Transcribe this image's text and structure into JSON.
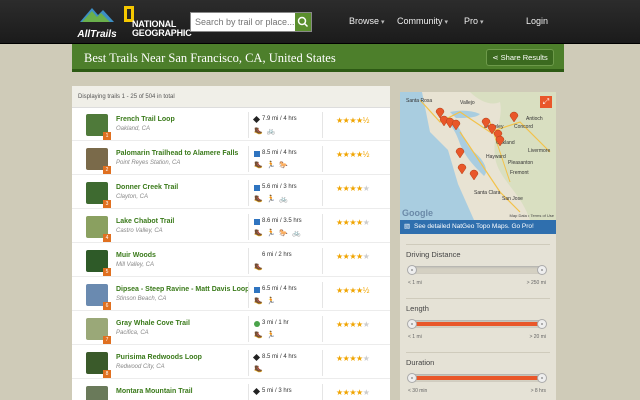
{
  "header": {
    "brand": "AllTrails",
    "partner_line1": "NATIONAL",
    "partner_line2": "GEOGRAPHIC",
    "search_placeholder": "Search by trail or place...",
    "nav": [
      "Browse",
      "Community",
      "Pro",
      "Login"
    ]
  },
  "titlebar": {
    "title": "Best Trails Near San Francisco, CA, United States",
    "share_label": "Share Results"
  },
  "list": {
    "count_text": "Displaying trails 1 - 25 of 504 in total",
    "rows": [
      {
        "name": "French Trail Loop",
        "loc": "Oakland, CA",
        "badge": "1",
        "diff": "black",
        "dist": "7.9 mi / 4 hrs",
        "acts": "🥾 🚲",
        "stars": "★★★★½",
        "empty": ""
      },
      {
        "name": "Palomarin Trailhead to Alamere Falls",
        "loc": "Point Reyes Station, CA",
        "badge": "2",
        "diff": "blue",
        "dist": "8.5 mi / 4 hrs",
        "acts": "🥾 🏃 🐎",
        "stars": "★★★★½",
        "empty": ""
      },
      {
        "name": "Donner Creek Trail",
        "loc": "Clayton, CA",
        "badge": "3",
        "diff": "blue",
        "dist": "5.6 mi / 3 hrs",
        "acts": "🥾 🏃 🚲",
        "stars": "★★★★",
        "empty": "★"
      },
      {
        "name": "Lake Chabot Trail",
        "loc": "Castro Valley, CA",
        "badge": "4",
        "diff": "blue",
        "dist": "8.6 mi / 3.5 hrs",
        "acts": "🥾 🏃 🐎 🚲",
        "stars": "★★★★",
        "empty": "★"
      },
      {
        "name": "Muir Woods",
        "loc": "Mill Valley, CA",
        "badge": "5",
        "diff": "none",
        "dist": "6 mi / 2 hrs",
        "acts": "🥾",
        "stars": "★★★★",
        "empty": "★"
      },
      {
        "name": "Dipsea - Steep Ravine - Matt Davis Loop",
        "loc": "Stinson Beach, CA",
        "badge": "6",
        "diff": "blue",
        "dist": "6.5 mi / 4 hrs",
        "acts": "🥾 🏃",
        "stars": "★★★★½",
        "empty": ""
      },
      {
        "name": "Gray Whale Cove Trail",
        "loc": "Pacifica, CA",
        "badge": "7",
        "diff": "green",
        "dist": "3 mi / 1 hr",
        "acts": "🥾 🏃",
        "stars": "★★★★",
        "empty": "★"
      },
      {
        "name": "Purisima Redwoods Loop",
        "loc": "Redwood City, CA",
        "badge": "8",
        "diff": "black",
        "dist": "8.5 mi / 4 hrs",
        "acts": "🥾",
        "stars": "★★★★",
        "empty": "★"
      },
      {
        "name": "Montara Mountain Trail",
        "loc": "",
        "badge": "9",
        "diff": "black",
        "dist": "5 mi / 3 hrs",
        "acts": "",
        "stars": "★★★★",
        "empty": "★"
      }
    ]
  },
  "map": {
    "google": "Google",
    "mapdata": "Map Data • Terms of Use",
    "places": [
      "Vallejo",
      "Berkeley",
      "Oakland",
      "Hayward",
      "Livermore",
      "Pleasanton",
      "Fremont",
      "Santa Clara",
      "San Jose",
      "Antioch",
      "Concord",
      "Santa Rosa"
    ],
    "natgeo_link": "See detailed NatGeo Topo Maps. Go Pro!"
  },
  "filters": [
    {
      "label": "Driving Distance",
      "min": "< 1 mi",
      "max": "> 250 mi",
      "lo": 0,
      "hi": 1,
      "filled": false
    },
    {
      "label": "Length",
      "min": "< 1 mi",
      "max": "> 20 mi",
      "lo": 0,
      "hi": 1,
      "filled": true
    },
    {
      "label": "Duration",
      "min": "< 30 min",
      "max": "> 8 hrs",
      "lo": 0,
      "hi": 1,
      "filled": true
    }
  ],
  "colors": {
    "accent_green": "#4d7f2b",
    "orange": "#e9572a",
    "link_blue": "#2f6fae"
  }
}
